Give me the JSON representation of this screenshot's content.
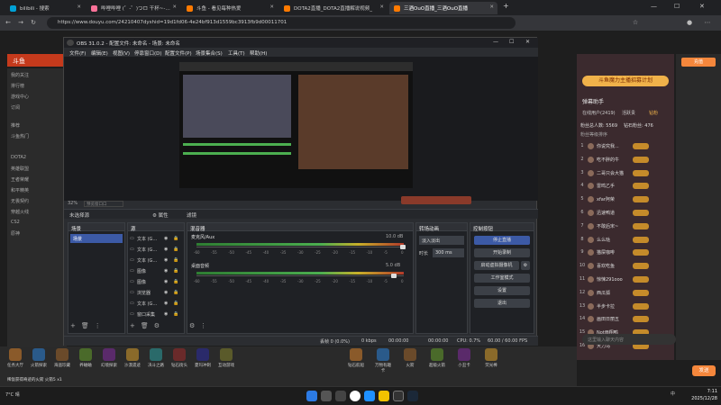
{
  "browser": {
    "tabs": [
      {
        "label": "bilibili - 搜索",
        "color": "#00a1d6"
      },
      {
        "label": "哔哩哔哩 (゜-゜)つロ 干杯~-bilibili",
        "color": "#fb7299"
      },
      {
        "label": "斗鱼 - 看见每种热爱",
        "color": "#ff7a00"
      },
      {
        "label": "DOTA2直播_DOTA2直播解说视频_",
        "color": "#ff7a00"
      },
      {
        "label": "三酒OuO直播_三酒OuO直播",
        "color": "#ff7a00"
      }
    ],
    "new_tab": "+",
    "url": "https://www.douyu.com/24210407dyshid=19d1fd06-4e24bf913d1559bc3913fb9d00011701"
  },
  "obs": {
    "title": "OBS 31.0.2 - 配置文件: 未命名 - 场景: 未命名",
    "menu": [
      "文件(F)",
      "编辑(E)",
      "视图(V)",
      "停靠窗口(D)",
      "配置文件(P)",
      "场景集合(S)",
      "工具(T)",
      "帮助(H)"
    ],
    "zoom": "32%",
    "preview_label": "预览窗口口",
    "no_source": "未选择源",
    "properties": "⚙ 属性",
    "filters": "滤镜",
    "scenes": {
      "title": "场景",
      "items": [
        "场景"
      ]
    },
    "sources": {
      "title": "源",
      "items": [
        "文本 (GDI+)",
        "文本 (GDI+)",
        "文本 (GDI+)",
        "图像",
        "图像",
        "浏览器",
        "文本 (GDI+)",
        "窗口采集"
      ]
    },
    "mixer": {
      "title": "混音器",
      "channels": [
        {
          "name": "麦克风/Aux",
          "db": "10.0 dB"
        },
        {
          "name": "桌面音频",
          "db": "5.0 dB"
        }
      ],
      "ticks": [
        "-60",
        "-55",
        "-50",
        "-45",
        "-40",
        "-35",
        "-30",
        "-25",
        "-20",
        "-15",
        "-10",
        "-5",
        "0"
      ]
    },
    "transitions": {
      "title": "转场动画",
      "type": "淡入淡出",
      "duration_label": "时长",
      "duration": "300 ms"
    },
    "controls": {
      "title": "控制按钮",
      "buttons": [
        "停止直播",
        "开始录制",
        "启动虚拟摄像机",
        "工作室模式",
        "设置",
        "退出"
      ]
    },
    "status": {
      "dropped": "丢帧 0 (0.0%)",
      "bitrate": "0 kbps",
      "live_time": "00:00:00",
      "rec_time": "00:00:00",
      "cpu": "CPU: 0.7%",
      "fps": "60.00 / 60.00 FPS"
    }
  },
  "douyu": {
    "logo": "斗鱼",
    "sidebar": [
      "我的关注",
      "排行榜",
      "游戏中心",
      "订阅",
      "推荐",
      "斗鱼热门",
      "DOTA2",
      "英雄联盟",
      "王者荣耀",
      "和平精英",
      "无畏契约",
      "穿越火线",
      "CS2",
      "原神"
    ],
    "anchor_label": "弹幕助手",
    "online_label": "在线用户(2419)",
    "tabs": [
      "在线用户(2419)",
      "活跃贵",
      "钻粉"
    ],
    "fans_total": "粉丝总人数: 5569",
    "diamond_fans": "钻石粉丝: 476",
    "rank_title": "粉丝等级排序",
    "ranks": [
      {
        "n": "1",
        "name": "你说究我..."
      },
      {
        "n": "2",
        "name": "吃不胖的牛"
      },
      {
        "n": "3",
        "name": "二哥只会大猫"
      },
      {
        "n": "4",
        "name": "雷鸣乙手"
      },
      {
        "n": "5",
        "name": "xfar阿荣"
      },
      {
        "n": "6",
        "name": "迅速鸭道"
      },
      {
        "n": "7",
        "name": "不敢后宋~"
      },
      {
        "n": "8",
        "name": "么么哒"
      },
      {
        "n": "9",
        "name": "猫屎咖啡"
      },
      {
        "n": "10",
        "name": "喜欢吃鱼"
      },
      {
        "n": "11",
        "name": "惊悚291ooo"
      },
      {
        "n": "12",
        "name": "西瓜狐"
      },
      {
        "n": "13",
        "name": "半步卡拉"
      },
      {
        "n": "14",
        "name": "画田日丽五"
      },
      {
        "n": "15",
        "name": "Not雨翔鸭"
      },
      {
        "n": "16",
        "name": "大力马"
      }
    ],
    "banner": "斗鱼魔力主播招募计划",
    "danmu_placeholder": "这里输入聊天内容",
    "send": "发送",
    "recharge": "充值",
    "gifts": [
      "任务大厅",
      "火箭探索",
      "海盗珍藏",
      "养蛐蛐",
      "幻境探索",
      "沙漠遗迹",
      "决斗之路",
      "钻石街头",
      "夏玛冲刺",
      "互动游戏"
    ],
    "right_gifts": [
      "钻石航船",
      "万物有趣卡",
      "火箭",
      "超级火箭",
      "小丑卡",
      "荧光棒"
    ],
    "footer_text": "稀饭获得奇迹的火箭 火箭5 x1"
  },
  "taskbar": {
    "time": "7:11",
    "date": "2025/12/28",
    "lang": "中",
    "weather": "7°C 晴"
  }
}
